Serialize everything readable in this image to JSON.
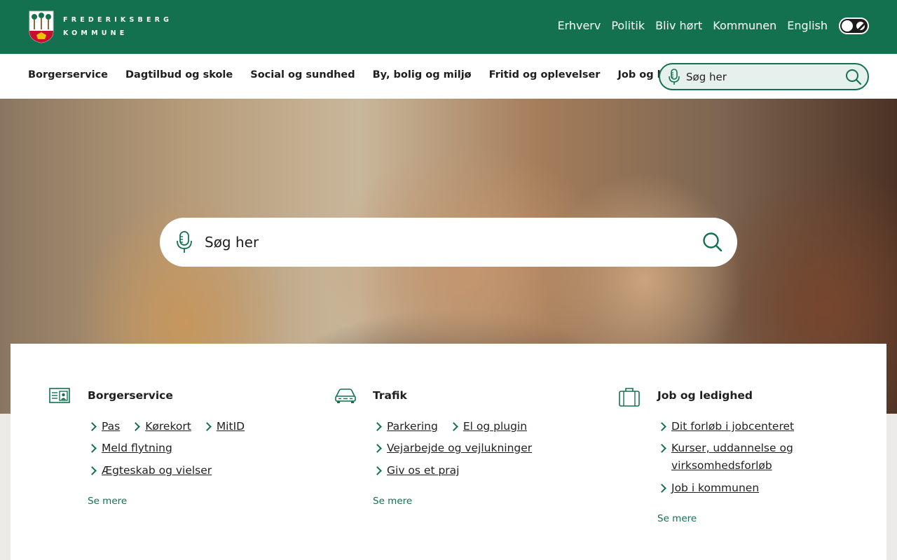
{
  "brand": {
    "line1": "FREDERIKSBERG",
    "line2": "KOMMUNE",
    "primary_color": "#13714f"
  },
  "toplinks": [
    "Erhverv",
    "Politik",
    "Bliv hørt",
    "Kommunen",
    "English"
  ],
  "contrast_toggle": {
    "icon": "contrast-toggle-icon"
  },
  "mainnav": [
    "Borgerservice",
    "Dagtilbud og skole",
    "Social og sundhed",
    "By, bolig og miljø",
    "Fritid og oplevelser",
    "Job og ledighed"
  ],
  "nav_search": {
    "placeholder": "Søg her",
    "mic_icon": "microphone-icon",
    "search_icon": "search-icon"
  },
  "hero_search": {
    "placeholder": "Søg her",
    "mic_icon": "microphone-icon",
    "search_icon": "search-icon"
  },
  "quicklinks": [
    {
      "title": "Borgerservice",
      "icon": "id-card-icon",
      "links": [
        "Pas",
        "Kørekort",
        "MitID",
        "Meld flytning",
        "Ægteskab og vielser"
      ],
      "more": "Se mere"
    },
    {
      "title": "Trafik",
      "icon": "car-icon",
      "links": [
        "Parkering",
        "El og plugin",
        "Vejarbejde og vejlukninger",
        "Giv os et praj"
      ],
      "more": "Se mere"
    },
    {
      "title": "Job og ledighed",
      "icon": "briefcase-icon",
      "links": [
        "Dit forløb i jobcenteret",
        "Kurser, uddannelse og virksomhedsforløb",
        "Job i kommunen"
      ],
      "more": "Se mere"
    }
  ]
}
